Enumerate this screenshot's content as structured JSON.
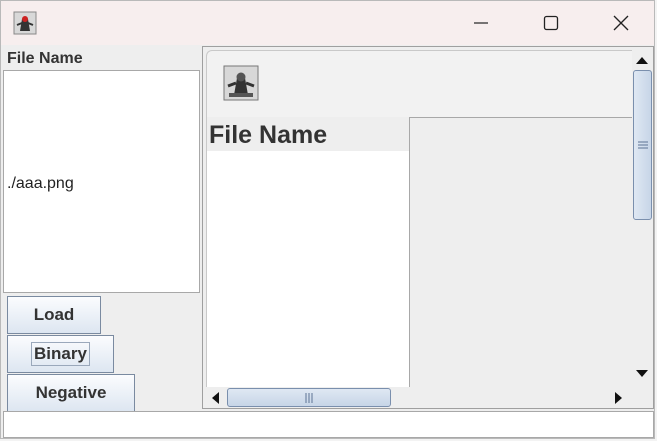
{
  "window": {
    "icon": "java-duke-icon",
    "controls": [
      "minimize-icon",
      "maximize-icon",
      "close-icon"
    ]
  },
  "left_panel": {
    "label": "File Name",
    "files": [
      "./aaa.png"
    ]
  },
  "buttons": {
    "load": "Load",
    "binary": "Binary",
    "negative": "Negative"
  },
  "preview": {
    "icon": "java-duke-icon",
    "label": "File Name"
  },
  "status": {
    "text": ""
  },
  "colors": {
    "titlebar": "#f7eeee",
    "button_border": "#7a8aa0",
    "scroll_thumb": "#c7d5e7"
  }
}
